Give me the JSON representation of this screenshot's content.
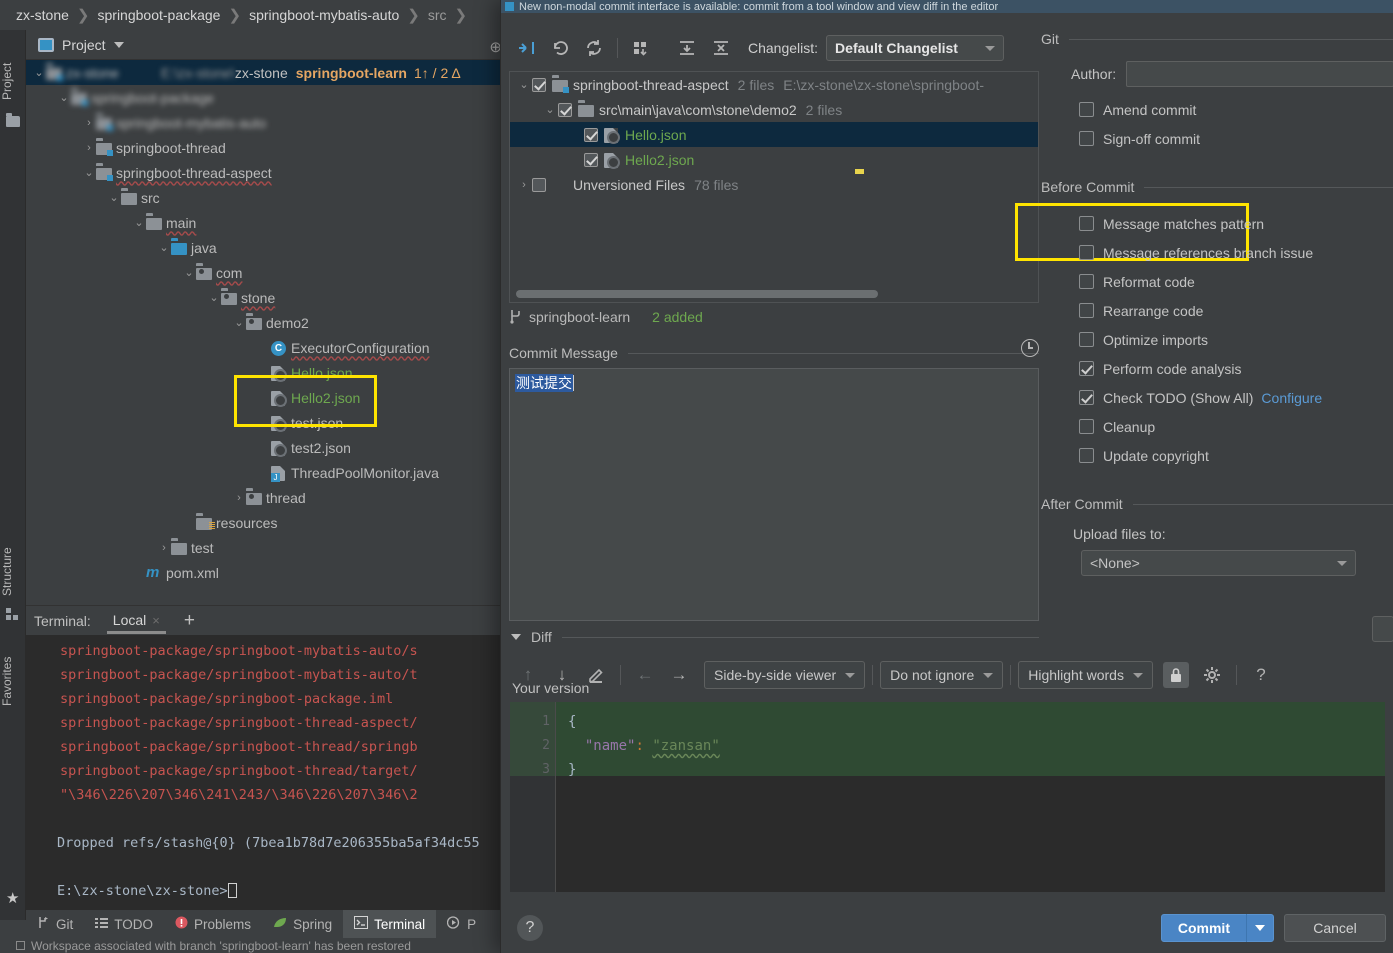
{
  "breadcrumb": {
    "items": [
      "zx-stone",
      "springboot-package",
      "springboot-mybatis-auto",
      "src"
    ],
    "separator": "❯"
  },
  "left_strip": {
    "tabs": [
      {
        "label": "Project",
        "icon": "project-icon"
      },
      {
        "label": "Structure",
        "icon": "structure-icon"
      },
      {
        "label": "Favorites",
        "icon": "star-icon"
      }
    ]
  },
  "project_panel": {
    "title": "Project",
    "caret": "chevron-down-icon",
    "tree": [
      {
        "indent": 0,
        "arrow": "⌄",
        "icon": "module",
        "label": "zx-stone",
        "blurred": true,
        "sel": true,
        "tail_left": "zx-stone",
        "tail_bold": "springboot-learn",
        "tail_stat": "1↑ / 2 Δ"
      },
      {
        "indent": 1,
        "arrow": "⌄",
        "icon": "module",
        "label": "springboot-package",
        "blurred": true
      },
      {
        "indent": 2,
        "arrow": "›",
        "icon": "module",
        "label": "springboot-mybatis-auto",
        "blurred": true
      },
      {
        "indent": 2,
        "arrow": "›",
        "icon": "module",
        "label": "springboot-thread"
      },
      {
        "indent": 2,
        "arrow": "⌄",
        "icon": "module",
        "label": "springboot-thread-aspect",
        "wavy": true
      },
      {
        "indent": 3,
        "arrow": "⌄",
        "icon": "folder",
        "label": "src"
      },
      {
        "indent": 4,
        "arrow": "⌄",
        "icon": "folder",
        "label": "main",
        "wavy": true
      },
      {
        "indent": 5,
        "arrow": "⌄",
        "icon": "folder-blue",
        "label": "java"
      },
      {
        "indent": 6,
        "arrow": "⌄",
        "icon": "package",
        "label": "com",
        "wavy": true
      },
      {
        "indent": 7,
        "arrow": "⌄",
        "icon": "package",
        "label": "stone",
        "wavy": true
      },
      {
        "indent": 8,
        "arrow": "⌄",
        "icon": "package",
        "label": "demo2"
      },
      {
        "indent": 9,
        "arrow": "",
        "icon": "class",
        "label": "ExecutorConfiguration",
        "wavy": true
      },
      {
        "indent": 9,
        "arrow": "",
        "icon": "json",
        "label": "Hello.json",
        "green": true
      },
      {
        "indent": 9,
        "arrow": "",
        "icon": "json",
        "label": "Hello2.json",
        "green": true
      },
      {
        "indent": 9,
        "arrow": "",
        "icon": "json",
        "label": "test.json"
      },
      {
        "indent": 9,
        "arrow": "",
        "icon": "json",
        "label": "test2.json"
      },
      {
        "indent": 9,
        "arrow": "",
        "icon": "java",
        "label": "ThreadPoolMonitor.java"
      },
      {
        "indent": 8,
        "arrow": "›",
        "icon": "package",
        "label": "thread"
      },
      {
        "indent": 6,
        "arrow": "",
        "icon": "resources",
        "label": "resources"
      },
      {
        "indent": 5,
        "arrow": "›",
        "icon": "folder",
        "label": "test"
      },
      {
        "indent": 4,
        "arrow": "",
        "icon": "maven",
        "label": "pom.xml"
      }
    ]
  },
  "terminal": {
    "label": "Terminal:",
    "tab": "Local",
    "close": "×",
    "add": "+",
    "lines": [
      {
        "text": "springboot-package/springboot-mybatis-auto/s",
        "color": "red"
      },
      {
        "text": "springboot-package/springboot-mybatis-auto/t",
        "color": "red"
      },
      {
        "text": "springboot-package/springboot-package.iml",
        "color": "red"
      },
      {
        "text": "springboot-package/springboot-thread-aspect/",
        "color": "red"
      },
      {
        "text": "springboot-package/springboot-thread/springb",
        "color": "red"
      },
      {
        "text": "springboot-package/springboot-thread/target/",
        "color": "red"
      },
      {
        "text": "\"\\346\\226\\207\\346\\241\\243/\\346\\226\\207\\346\\2",
        "color": "red"
      }
    ],
    "dropped_line": "Dropped refs/stash@{0} (7bea1b78d7e206355ba5af34dc55",
    "prompt": "E:\\zx-stone\\zx-stone>"
  },
  "bottom_tabs": [
    {
      "label": "Git",
      "icon": "git-branch-icon",
      "active": false
    },
    {
      "label": "TODO",
      "icon": "list-icon",
      "active": false
    },
    {
      "label": "Problems",
      "icon": "error-icon",
      "active": false
    },
    {
      "label": "Spring",
      "icon": "leaf-icon",
      "active": false
    },
    {
      "label": "Terminal",
      "icon": "terminal-icon",
      "active": true
    },
    {
      "label": "P",
      "icon": "run-icon",
      "active": false
    }
  ],
  "statusbar": {
    "message": "Workspace associated with branch 'springboot-learn' has been restored",
    "right": "​"
  },
  "dialog": {
    "notification": "New non-modal commit interface is available: commit from a tool window and view diff in the editor",
    "toolbar": {
      "buttons": [
        {
          "icon": "collapse-diff-icon",
          "name": "show-diff-button"
        },
        {
          "icon": "rollback-icon",
          "name": "revert-button"
        },
        {
          "icon": "refresh-icon",
          "name": "refresh-button"
        },
        {
          "icon": "group-by-icon",
          "name": "group-by-button"
        },
        {
          "icon": "expand-all-icon",
          "name": "expand-all-button"
        },
        {
          "icon": "collapse-all-icon",
          "name": "collapse-all-button"
        }
      ],
      "changelist_label": "Changelist:",
      "changelist_value": "Default Changelist"
    },
    "changes": [
      {
        "indent": 0,
        "arrow": "⌄",
        "checked": true,
        "icon": "module-icon",
        "label": "springboot-thread-aspect",
        "meta1": "2 files",
        "meta2": "E:\\zx-stone\\zx-stone\\springboot-",
        "sel": false
      },
      {
        "indent": 1,
        "arrow": "⌄",
        "checked": true,
        "icon": "folder-icon",
        "label": "src\\main\\java\\com\\stone\\demo2",
        "meta1": "2 files",
        "meta2": "",
        "sel": false
      },
      {
        "indent": 2,
        "arrow": "",
        "checked": true,
        "icon": "json-icon",
        "label": "Hello.json",
        "green": true,
        "meta1": "",
        "meta2": "",
        "sel": true
      },
      {
        "indent": 2,
        "arrow": "",
        "checked": true,
        "icon": "json-icon",
        "label": "Hello2.json",
        "green": true,
        "meta1": "",
        "meta2": "",
        "sel": false
      },
      {
        "indent": 0,
        "arrow": "›",
        "checked": false,
        "icon": "",
        "label": "Unversioned Files",
        "meta1": "78 files",
        "meta2": "",
        "sel": false
      }
    ],
    "branch": {
      "icon": "git-branch-icon",
      "name": "springboot-learn",
      "added": "2 added"
    },
    "commit_message": {
      "title": "Commit Message",
      "history_icon": "clock-icon",
      "value": "测试提交"
    },
    "diff": {
      "title": "Diff",
      "nav": [
        {
          "icon": "arrow-up-icon",
          "name": "previous-difference-button",
          "dim": true
        },
        {
          "icon": "arrow-down-icon",
          "name": "next-difference-button",
          "dim": false
        },
        {
          "icon": "edit-icon",
          "name": "edit-source-button",
          "dim": false
        },
        {
          "icon": "arrow-left-icon",
          "name": "accept-left-button",
          "dim": true
        },
        {
          "icon": "arrow-right-icon",
          "name": "accept-right-button",
          "dim": false
        }
      ],
      "viewer_mode": "Side-by-side viewer",
      "ignore_mode": "Do not ignore",
      "highlight_mode": "Highlight words",
      "lock_icon": "lock-icon",
      "settings_icon": "gear-icon",
      "help_icon": "question-icon",
      "pane_title": "Your version",
      "lines": [
        {
          "no": "1",
          "tokens": [
            {
              "t": "{",
              "c": "punc"
            }
          ]
        },
        {
          "no": "2",
          "tokens": [
            {
              "t": "  ",
              "c": "punc"
            },
            {
              "t": "\"name\"",
              "c": "key"
            },
            {
              "t": ":",
              "c": "colon"
            },
            {
              "t": " ",
              "c": "punc"
            },
            {
              "t": "\"zansan\"",
              "c": "str-wavy"
            }
          ]
        },
        {
          "no": "3",
          "tokens": [
            {
              "t": "}",
              "c": "punc"
            }
          ]
        }
      ]
    },
    "options": {
      "git": {
        "title": "Git",
        "author_label": "Author:",
        "author_value": "",
        "checkboxes": [
          {
            "label": "Amend commit",
            "checked": false
          },
          {
            "label": "Sign-off commit",
            "checked": false
          }
        ]
      },
      "before_commit": {
        "title": "Before Commit",
        "checkboxes": [
          {
            "label": "Message matches pattern",
            "checked": false
          },
          {
            "label": "Message references branch issue",
            "checked": false
          },
          {
            "label": "Reformat code",
            "checked": false
          },
          {
            "label": "Rearrange code",
            "checked": false
          },
          {
            "label": "Optimize imports",
            "checked": false
          },
          {
            "label": "Perform code analysis",
            "checked": true
          },
          {
            "label": "Check TODO (Show All)",
            "checked": true,
            "link": "Configure"
          },
          {
            "label": "Cleanup",
            "checked": false
          },
          {
            "label": "Update copyright",
            "checked": false
          }
        ]
      },
      "after_commit": {
        "title": "After Commit",
        "upload_label": "Upload files to:",
        "upload_value": "<None>"
      }
    },
    "footer": {
      "help": "?",
      "commit": "Commit",
      "commit_caret": "chevron-down-icon",
      "cancel": "Cancel"
    }
  },
  "colors": {
    "accent_blue": "#4a85c5",
    "highlight_yellow": "#ffe400",
    "added_green": "#6ea84f",
    "selection_navy": "#0d293e",
    "terminal_red": "#c75450",
    "link_blue": "#5b9bd5"
  }
}
